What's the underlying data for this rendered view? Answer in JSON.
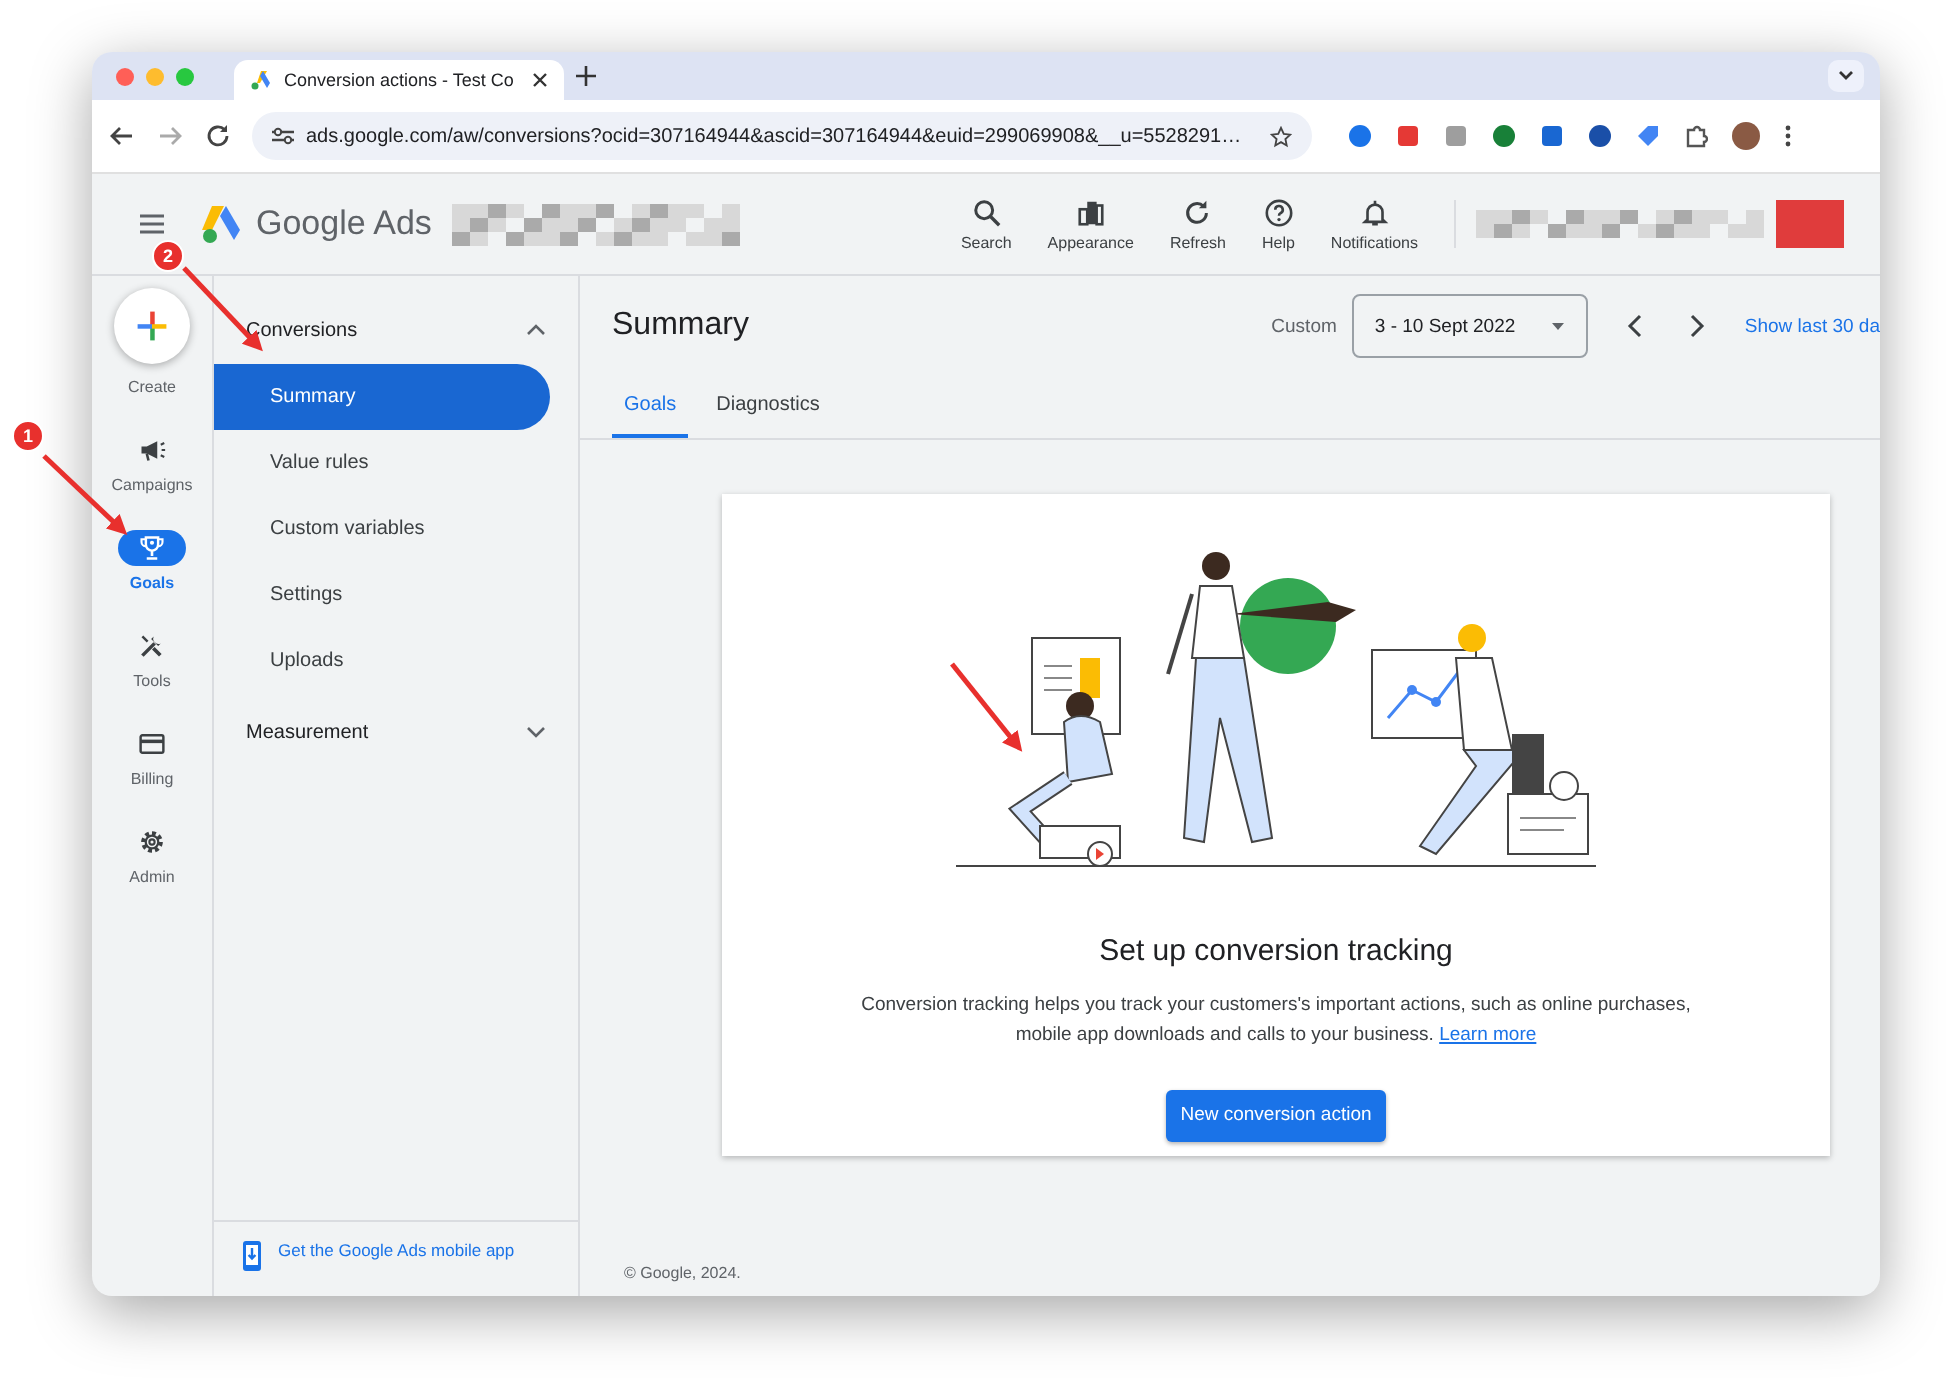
{
  "browser": {
    "tab_title": "Conversion actions - Test Co",
    "url": "ads.google.com/aw/conversions?ocid=307164944&ascid=307164944&euid=299069908&__u=5528291…"
  },
  "header": {
    "product": "Google Ads",
    "actions": [
      {
        "label": "Search",
        "kind": "search"
      },
      {
        "label": "Appearance",
        "kind": "appearance"
      },
      {
        "label": "Refresh",
        "kind": "refresh"
      },
      {
        "label": "Help",
        "kind": "help"
      },
      {
        "label": "Notifications",
        "kind": "bell"
      }
    ]
  },
  "rail": [
    {
      "label": "Create",
      "kind": "create"
    },
    {
      "label": "Campaigns",
      "kind": "megaphone",
      "selected": false
    },
    {
      "label": "Goals",
      "kind": "trophy",
      "selected": true
    },
    {
      "label": "Tools",
      "kind": "tools",
      "selected": false
    },
    {
      "label": "Billing",
      "kind": "card",
      "selected": false
    },
    {
      "label": "Admin",
      "kind": "gear",
      "selected": false
    }
  ],
  "nav": [
    {
      "label": "Conversions",
      "expanded": true,
      "children": [
        {
          "label": "Summary",
          "selected": true
        },
        {
          "label": "Value rules",
          "selected": false
        },
        {
          "label": "Custom variables",
          "selected": false
        },
        {
          "label": "Settings",
          "selected": false
        },
        {
          "label": "Uploads",
          "selected": false
        }
      ]
    },
    {
      "label": "Measurement",
      "expanded": false
    }
  ],
  "mobile_link": "Get the Google Ads mobile app",
  "page": {
    "title": "Summary",
    "date_label": "Custom",
    "date_range": "3 - 10 Sept 2022",
    "show_last": "Show last 30 da",
    "tabs": [
      {
        "label": "Goals",
        "selected": true
      },
      {
        "label": "Diagnostics",
        "selected": false
      }
    ]
  },
  "card": {
    "heading": "Set up conversion tracking",
    "body": "Conversion tracking helps you track your customers's important actions, such as online purchases, mobile app downloads and calls to your business.",
    "link": "Learn more",
    "button": "New conversion action"
  },
  "footer": "© Google, 2024.",
  "annotations": [
    {
      "kind": "badge-arrow",
      "number": "1"
    },
    {
      "kind": "badge-arrow",
      "number": "2"
    },
    {
      "kind": "arrow"
    }
  ]
}
